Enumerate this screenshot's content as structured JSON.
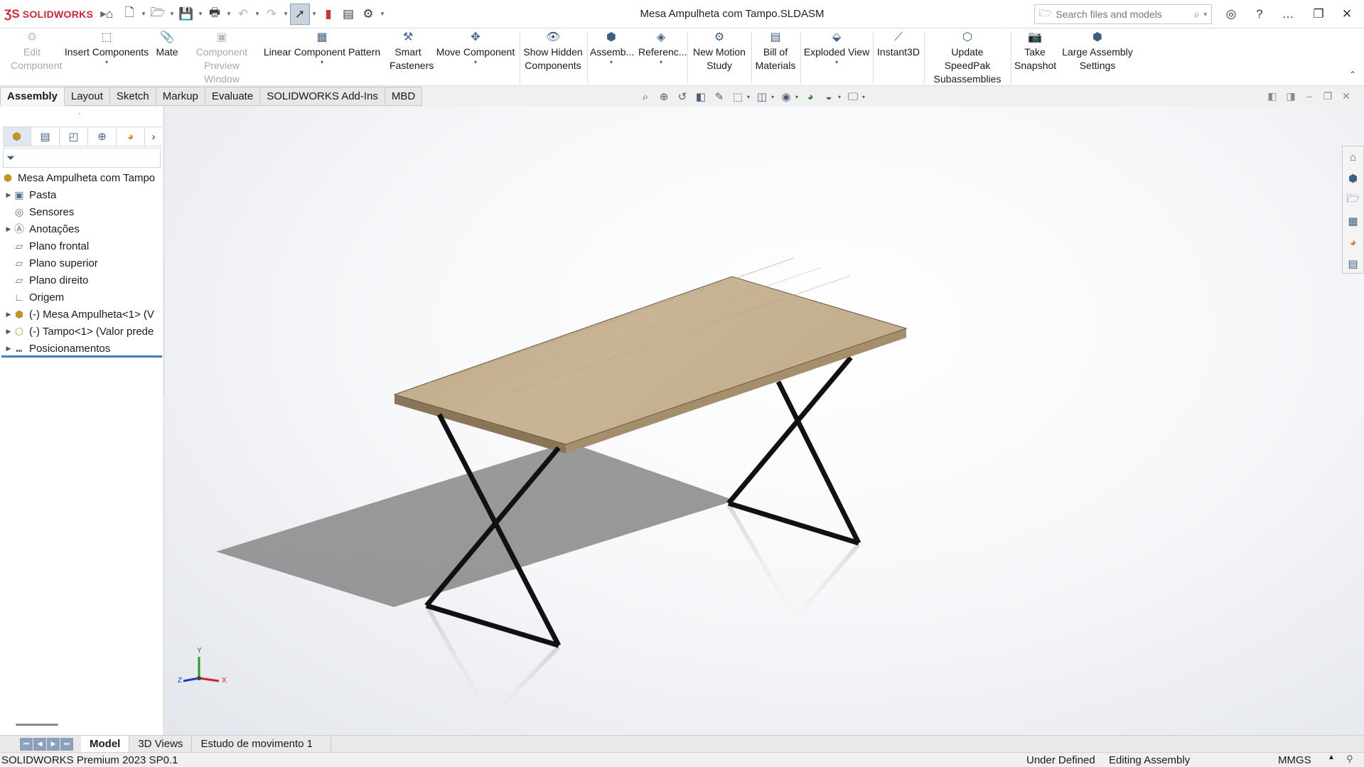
{
  "app": {
    "brand": "SOLIDWORKS",
    "document_title": "Mesa Ampulheta com Tampo.SLDASM"
  },
  "search": {
    "placeholder": "Search files and models"
  },
  "command_manager": {
    "edit_component": "Edit Component",
    "insert_components": "Insert Components",
    "mate": "Mate",
    "component_preview_window": "Component Preview Window",
    "linear_component_pattern": "Linear Component Pattern",
    "smart_fasteners": "Smart Fasteners",
    "move_component": "Move Component",
    "show_hidden_components": "Show Hidden Components",
    "assembly": "Assemb...",
    "reference": "Referenc...",
    "new_motion_study": "New Motion Study",
    "bill_of_materials": "Bill of Materials",
    "exploded_view": "Exploded View",
    "instant3d": "Instant3D",
    "update_speedpak": "Update SpeedPak Subassemblies",
    "take_snapshot": "Take Snapshot",
    "large_assembly_settings": "Large Assembly Settings"
  },
  "tabs": [
    "Assembly",
    "Layout",
    "Sketch",
    "Markup",
    "Evaluate",
    "SOLIDWORKS Add-Ins",
    "MBD"
  ],
  "tree": {
    "root": "Mesa Ampulheta com Tampo",
    "items": [
      "Pasta",
      "Sensores",
      "Anotações",
      "Plano frontal",
      "Plano superior",
      "Plano direito",
      "Origem",
      "(-) Mesa Ampulheta<1> (V",
      "(-) Tampo<1> (Valor prede",
      "Posicionamentos"
    ]
  },
  "triad": {
    "x": "X",
    "y": "Y",
    "z": "Z"
  },
  "bottom_tabs": [
    "Model",
    "3D Views",
    "Estudo de movimento 1"
  ],
  "status": {
    "version": "SOLIDWORKS Premium 2023 SP0.1",
    "definition": "Under Defined",
    "mode": "Editing Assembly",
    "units": "MMGS"
  },
  "colors": {
    "accent": "#d5232f",
    "wood": "#c8b494",
    "legs": "#111111"
  }
}
